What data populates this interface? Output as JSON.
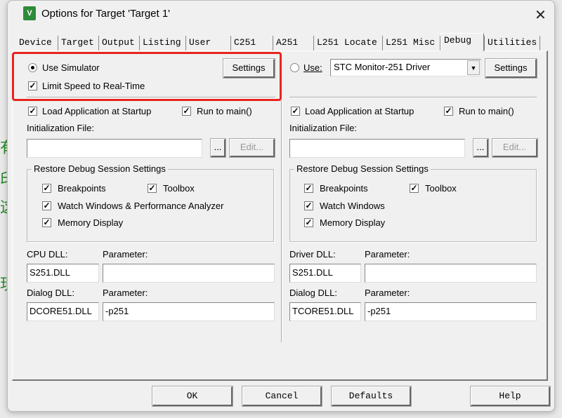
{
  "window": {
    "title": "Options for Target 'Target 1'",
    "close_icon": "close-icon"
  },
  "tabs": [
    "Device",
    "Target",
    "Output",
    "Listing",
    "User",
    "C251",
    "A251",
    "L251 Locate",
    "L251 Misc",
    "Debug",
    "Utilities"
  ],
  "active_tab": "Debug",
  "left": {
    "use_simulator": "Use Simulator",
    "settings": "Settings",
    "limit_speed": "Limit Speed to Real-Time",
    "load_app": "Load Application at Startup",
    "run_main": "Run to main()",
    "init_file_label": "Initialization File:",
    "init_file_value": "",
    "browse": "...",
    "edit": "Edit...",
    "restore_group": "Restore Debug Session Settings",
    "breakpoints": "Breakpoints",
    "toolbox": "Toolbox",
    "watch": "Watch Windows & Performance Analyzer",
    "memory": "Memory Display",
    "cpu_dll_label": "CPU DLL:",
    "cpu_param_label": "Parameter:",
    "cpu_dll": "S251.DLL",
    "cpu_param": "",
    "dialog_dll_label": "Dialog DLL:",
    "dialog_param_label": "Parameter:",
    "dialog_dll": "DCORE51.DLL",
    "dialog_param": "-p251"
  },
  "right": {
    "use": "Use:",
    "driver": "STC Monitor-251 Driver",
    "settings": "Settings",
    "load_app": "Load Application at Startup",
    "run_main": "Run to main()",
    "init_file_label": "Initialization File:",
    "init_file_value": "",
    "browse": "...",
    "edit": "Edit...",
    "restore_group": "Restore Debug Session Settings",
    "breakpoints": "Breakpoints",
    "toolbox": "Toolbox",
    "watch": "Watch Windows",
    "memory": "Memory Display",
    "driver_dll_label": "Driver DLL:",
    "driver_param_label": "Parameter:",
    "driver_dll": "S251.DLL",
    "driver_param": "",
    "dialog_dll_label": "Dialog DLL:",
    "dialog_param_label": "Parameter:",
    "dialog_dll": "TCORE51.DLL",
    "dialog_param": "-p251"
  },
  "footer": {
    "ok": "OK",
    "cancel": "Cancel",
    "defaults": "Defaults",
    "help": "Help"
  },
  "colors": {
    "highlight": "#e8251e"
  }
}
